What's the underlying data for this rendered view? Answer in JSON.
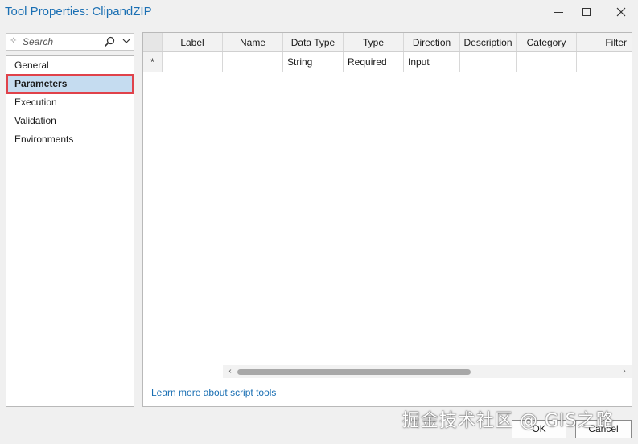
{
  "window": {
    "title": "Tool Properties: ClipandZIP"
  },
  "search": {
    "placeholder": "Search"
  },
  "nav": {
    "items": [
      {
        "label": "General"
      },
      {
        "label": "Parameters"
      },
      {
        "label": "Execution"
      },
      {
        "label": "Validation"
      },
      {
        "label": "Environments"
      }
    ],
    "selected": "Parameters"
  },
  "grid": {
    "columns": [
      "",
      "Label",
      "Name",
      "Data Type",
      "Type",
      "Direction",
      "Description",
      "Category",
      "Filter"
    ],
    "rows": [
      [
        "*",
        "",
        "",
        "String",
        "Required",
        "Input",
        "",
        "",
        ""
      ]
    ]
  },
  "link": {
    "text": "Learn more about script tools"
  },
  "buttons": {
    "ok": "OK",
    "cancel": "Cancel"
  },
  "watermark": "掘金技术社区 @ GIS之路",
  "colors": {
    "title": "#1a6fb3",
    "selection": "#c5dcf0",
    "highlight": "#e0424a",
    "link": "#1a6fb3"
  }
}
